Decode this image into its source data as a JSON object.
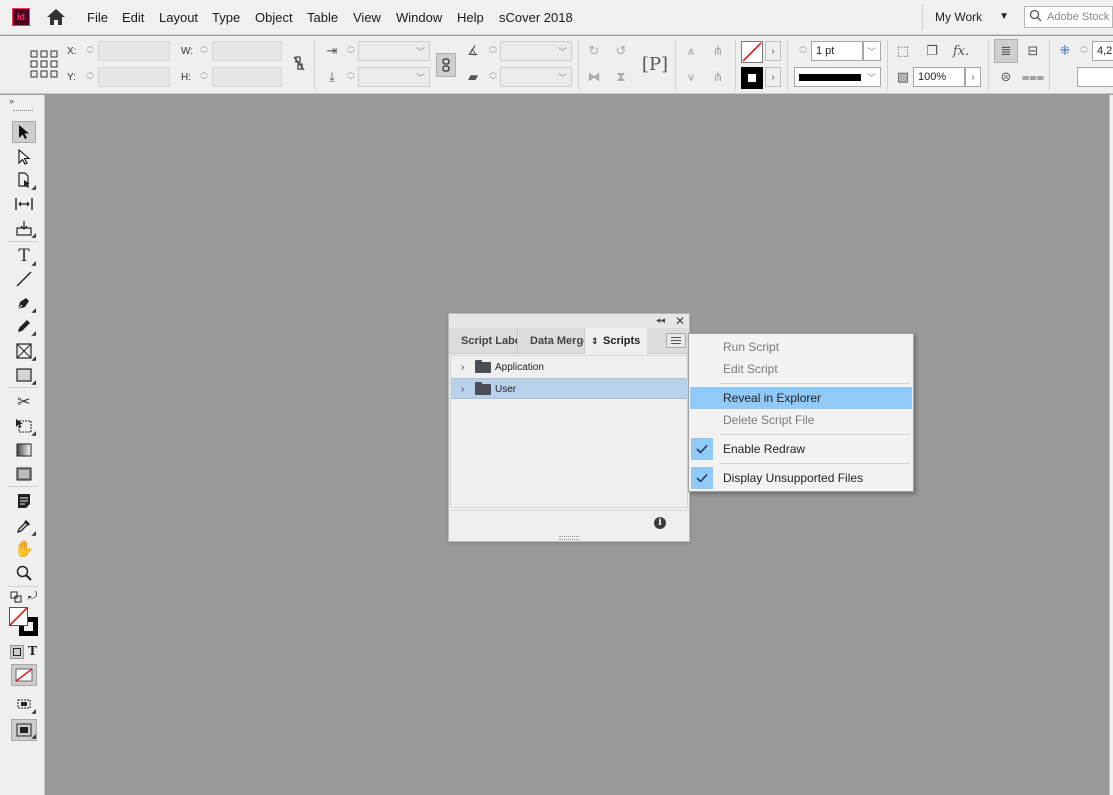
{
  "app": {
    "logo_text": "Id",
    "document_title": "sCover 2018",
    "brand_color": "#49021f",
    "accent_color": "#ff3366"
  },
  "menubar": {
    "items": [
      "File",
      "Edit",
      "Layout",
      "Type",
      "Object",
      "Table",
      "View",
      "Window",
      "Help"
    ],
    "workspace_label": "My Work",
    "stock_search_placeholder": "Adobe Stock"
  },
  "control_panel": {
    "x_label": "X:",
    "y_label": "Y:",
    "w_label": "W:",
    "h_label": "H:",
    "x_value": "",
    "y_value": "",
    "w_value": "",
    "h_value": "",
    "stroke_weight": "1 pt",
    "opacity": "100%",
    "partial_value": "4,2"
  },
  "toolbox": {
    "tools": [
      "selection-tool",
      "direct-selection-tool",
      "page-tool",
      "gap-tool",
      "content-collector-tool",
      "type-tool",
      "line-tool",
      "pen-tool",
      "pencil-tool",
      "rectangle-frame-tool",
      "rectangle-tool",
      "scissors-tool",
      "free-transform-tool",
      "gradient-swatch-tool",
      "gradient-feather-tool",
      "note-tool",
      "eyedropper-tool",
      "hand-tool",
      "zoom-tool"
    ],
    "selected_tool": "selection-tool"
  },
  "scripts_panel": {
    "tabs": [
      {
        "label": "Script Label",
        "active": false
      },
      {
        "label": "Data Merge",
        "active": false
      },
      {
        "label": "Scripts",
        "active": true
      }
    ],
    "tree": [
      {
        "label": "Application",
        "selected": false
      },
      {
        "label": "User",
        "selected": true
      }
    ]
  },
  "context_menu": {
    "items": [
      {
        "label": "Run Script",
        "state": "disabled"
      },
      {
        "label": "Edit Script",
        "state": "disabled"
      },
      {
        "label": "Reveal in Explorer",
        "state": "highlighted"
      },
      {
        "label": "Delete Script File",
        "state": "disabled"
      },
      {
        "label": "Enable Redraw",
        "state": "checked"
      },
      {
        "label": "Display Unsupported Files",
        "state": "checked"
      }
    ],
    "highlight_color": "#91c9f7"
  }
}
